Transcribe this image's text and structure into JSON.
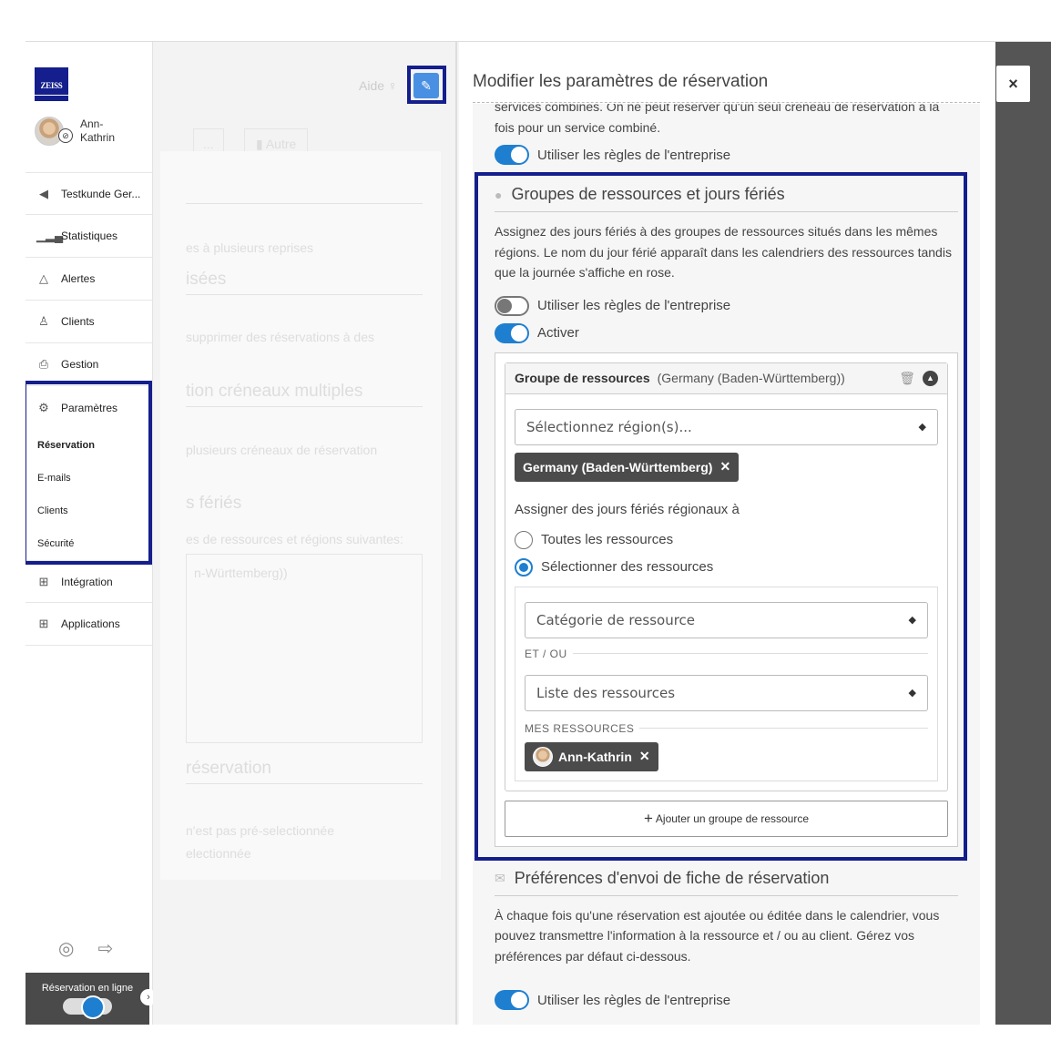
{
  "brand": {
    "logo_text": "ZEISS"
  },
  "user": {
    "name": "Ann-Kathrin"
  },
  "sidebar": {
    "items": [
      {
        "label": "Testkunde Ger...",
        "icon": "back-circle-icon"
      },
      {
        "label": "Statistiques",
        "icon": "chart-icon"
      },
      {
        "label": "Alertes",
        "icon": "bell-icon"
      },
      {
        "label": "Clients",
        "icon": "person-icon"
      },
      {
        "label": "Gestion",
        "icon": "printer-icon"
      },
      {
        "label": "Paramètres",
        "icon": "gears-icon"
      }
    ],
    "sub_items": [
      {
        "label": "Réservation",
        "active": true
      },
      {
        "label": "E-mails"
      },
      {
        "label": "Clients"
      },
      {
        "label": "Sécurité"
      }
    ],
    "items_after": [
      {
        "label": "Intégration",
        "icon": "integration-icon"
      },
      {
        "label": "Applications",
        "icon": "grid-icon"
      }
    ],
    "online_label": "Réservation en ligne"
  },
  "middle": {
    "aide": "Aide",
    "autre": "Autre",
    "ghost_texts": [
      "es à plusieurs reprises",
      "isées",
      "supprimer des réservations à des",
      "tion créneaux multiples",
      "plusieurs créneaux de réservation",
      "s fériés",
      "es de ressources et régions suivantes:",
      "n-Württemberg))",
      "réservation",
      "n'est pas pré-selectionnée",
      "electionnée"
    ]
  },
  "modal": {
    "title": "Modifier les paramètres de réservation",
    "intro_text": "services combinés. On ne peut réserver qu'un seul créneau de réservation à la fois pour un service combiné.",
    "use_company_rules": "Utiliser les règles de l'entreprise",
    "groups_section": {
      "title": "Groupes de ressources et jours fériés",
      "description": "Assignez des jours fériés à des groupes de ressources situés dans les mêmes régions. Le nom du jour férié apparaît dans les calendriers des ressources tandis que la journée s'affiche en rose.",
      "use_company_rules": "Utiliser les règles de l'entreprise",
      "activate": "Activer",
      "group_label": "Groupe de ressources",
      "group_region": "(Germany (Baden-Württemberg))",
      "region_placeholder": "Sélectionnez région(s)...",
      "region_chip": "Germany (Baden-Württemberg)",
      "assign_label": "Assigner des jours fériés régionaux à",
      "radio_all": "Toutes les ressources",
      "radio_select": "Sélectionner des ressources",
      "category_placeholder": "Catégorie de ressource",
      "and_or": "ET / OU",
      "resource_list_placeholder": "Liste des ressources",
      "my_resources": "MES RESSOURCES",
      "resource_chip": "Ann-Kathrin",
      "add_group": "Ajouter un groupe de ressource"
    },
    "prefs_section": {
      "title": "Préférences d'envoi de fiche de réservation",
      "description": "À chaque fois qu'une réservation est ajoutée ou éditée dans le calendrier, vous pouvez transmettre l'information à la ressource et / ou au client. Gérez vos préférences par défaut ci-dessous.",
      "use_company_rules": "Utiliser les règles de l'entreprise"
    },
    "close": "×"
  },
  "colors": {
    "accent": "#1e7fd0",
    "highlight": "#141e8c",
    "chip": "#4b4b4b"
  }
}
